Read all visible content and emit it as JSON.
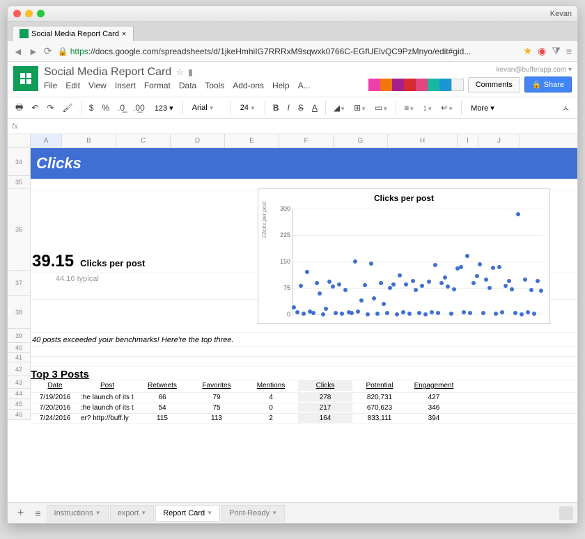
{
  "titlebar": {
    "user": "Kevan"
  },
  "browser_tab": {
    "label": "Social Media Report Card"
  },
  "url": {
    "prefix": "https",
    "text": "://docs.google.com/spreadsheets/d/1jkeHmhiIG7RRRxM9sqwxk0766C-EGfUElvQC9PzMnyo/edit#gid..."
  },
  "doc": {
    "title": "Social Media Report Card",
    "email": "kevan@bufferapp.com ▾",
    "menu": [
      "File",
      "Edit",
      "View",
      "Insert",
      "Format",
      "Data",
      "Tools",
      "Add-ons",
      "Help",
      "A..."
    ],
    "comments": "Comments",
    "share": "Share"
  },
  "toolbar": {
    "currency": "$",
    "percent": "%",
    "dec0": ".0←",
    "dec00": ".00→",
    "numfmt": "123 ▾",
    "font": "Arial",
    "fontsize": "24",
    "more": "More ▾"
  },
  "fx": "fx",
  "columns": [
    "A",
    "B",
    "C",
    "D",
    "E",
    "F",
    "G",
    "H",
    "I",
    "J"
  ],
  "rows": {
    "34": "34",
    "35": "35",
    "36": "36",
    "37": "37",
    "38": "38",
    "39": "39",
    "40": "40",
    "41": "41",
    "42": "42",
    "43": "43",
    "44": "44",
    "45": "45",
    "46": "46"
  },
  "sheet": {
    "bluebar": "Clicks",
    "bignum": "39.15",
    "metriclabel": "Clicks per post",
    "typical": "44.16  typical",
    "note": "40 posts exceeded your benchmarks! Here're the top three.",
    "section": "Top 3 Posts",
    "headers": [
      "Date",
      "Post",
      "Retweets",
      "Favorites",
      "Mentions",
      "Clicks",
      "Potential",
      "Engagement"
    ],
    "r1": [
      "7/19/2016",
      ":he launch of its t",
      "66",
      "79",
      "4",
      "278",
      "820,731",
      "427"
    ],
    "r2": [
      "7/20/2016",
      ":he launch of its t",
      "54",
      "75",
      "0",
      "217",
      "670,623",
      "346"
    ],
    "r3": [
      "7/24/2016",
      "er? http://buff.ly",
      "115",
      "113",
      "2",
      "164",
      "833,111",
      "394"
    ]
  },
  "tabs": {
    "instructions": "Instructions",
    "export": "export",
    "reportcard": "Report Card",
    "printready": "Print-Ready"
  },
  "chart_data": {
    "type": "scatter",
    "title": "Clicks per post",
    "ylabel": "Clicks per post",
    "xlabel": "",
    "ylim": [
      0,
      300
    ],
    "yticks": [
      0,
      75,
      150,
      225,
      300
    ],
    "values": [
      20,
      5,
      80,
      2,
      120,
      8,
      3,
      88,
      60,
      1,
      15,
      92,
      78,
      4,
      85,
      2,
      70,
      6,
      3,
      150,
      7,
      40,
      82,
      1,
      145,
      45,
      2,
      88,
      30,
      3,
      75,
      85,
      1,
      110,
      5,
      85,
      2,
      95,
      70,
      4,
      80,
      1,
      92,
      6,
      140,
      3,
      88,
      105,
      78,
      2,
      72,
      130,
      135,
      5,
      165,
      3,
      88,
      108,
      142,
      4,
      98,
      75,
      132,
      2,
      135,
      5,
      80,
      95,
      72,
      3,
      285,
      1,
      98,
      5,
      70,
      2,
      95,
      68
    ]
  }
}
